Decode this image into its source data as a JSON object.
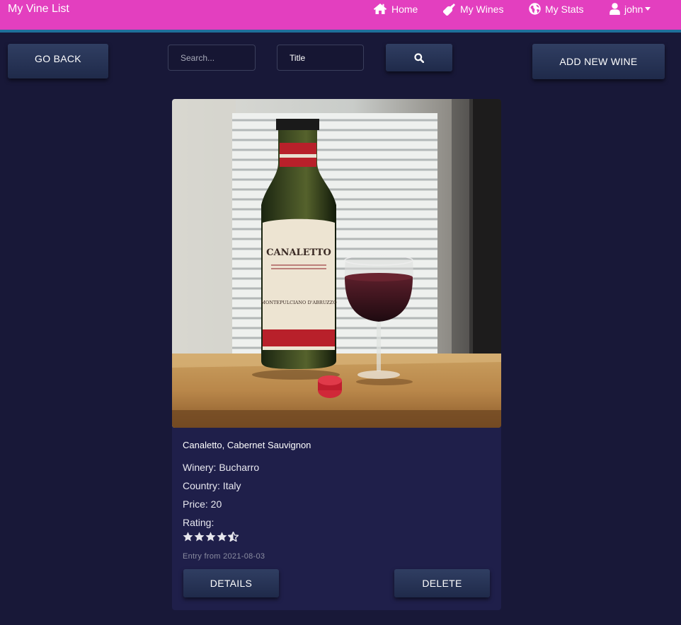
{
  "app": {
    "title": "My Vine List"
  },
  "nav": {
    "home": {
      "label": "Home",
      "icon": "home-icon"
    },
    "wines": {
      "label": "My Wines",
      "icon": "wine-bottle-icon"
    },
    "stats": {
      "label": "My Stats",
      "icon": "globe-icon"
    },
    "user": {
      "label": "john",
      "icon": "user-icon"
    }
  },
  "toolbar": {
    "go_back_label": "GO BACK",
    "search_placeholder": "Search...",
    "filter_value": "Title",
    "search_button_icon": "search-icon",
    "add_new_label": "ADD NEW WINE"
  },
  "wine": {
    "title": "Canaletto, Cabernet Sauvignon",
    "winery": "Winery: Bucharro",
    "country": "Country: Italy",
    "price": "Price: 20",
    "rating_label": "Rating:",
    "rating": 4.5,
    "rating_max": 5,
    "entry": "Entry from 2021-08-03",
    "details_label": "DETAILS",
    "delete_label": "DELETE",
    "image_labels": {
      "brand": "CANALETTO",
      "type": "MONTEPULCIANO D'ABRUZZO"
    }
  },
  "colors": {
    "navbar": "#e33fbf",
    "navbar_border": "#1f6f9a",
    "background": "#181838",
    "card": "#1f1f4a",
    "button": "#283556"
  }
}
